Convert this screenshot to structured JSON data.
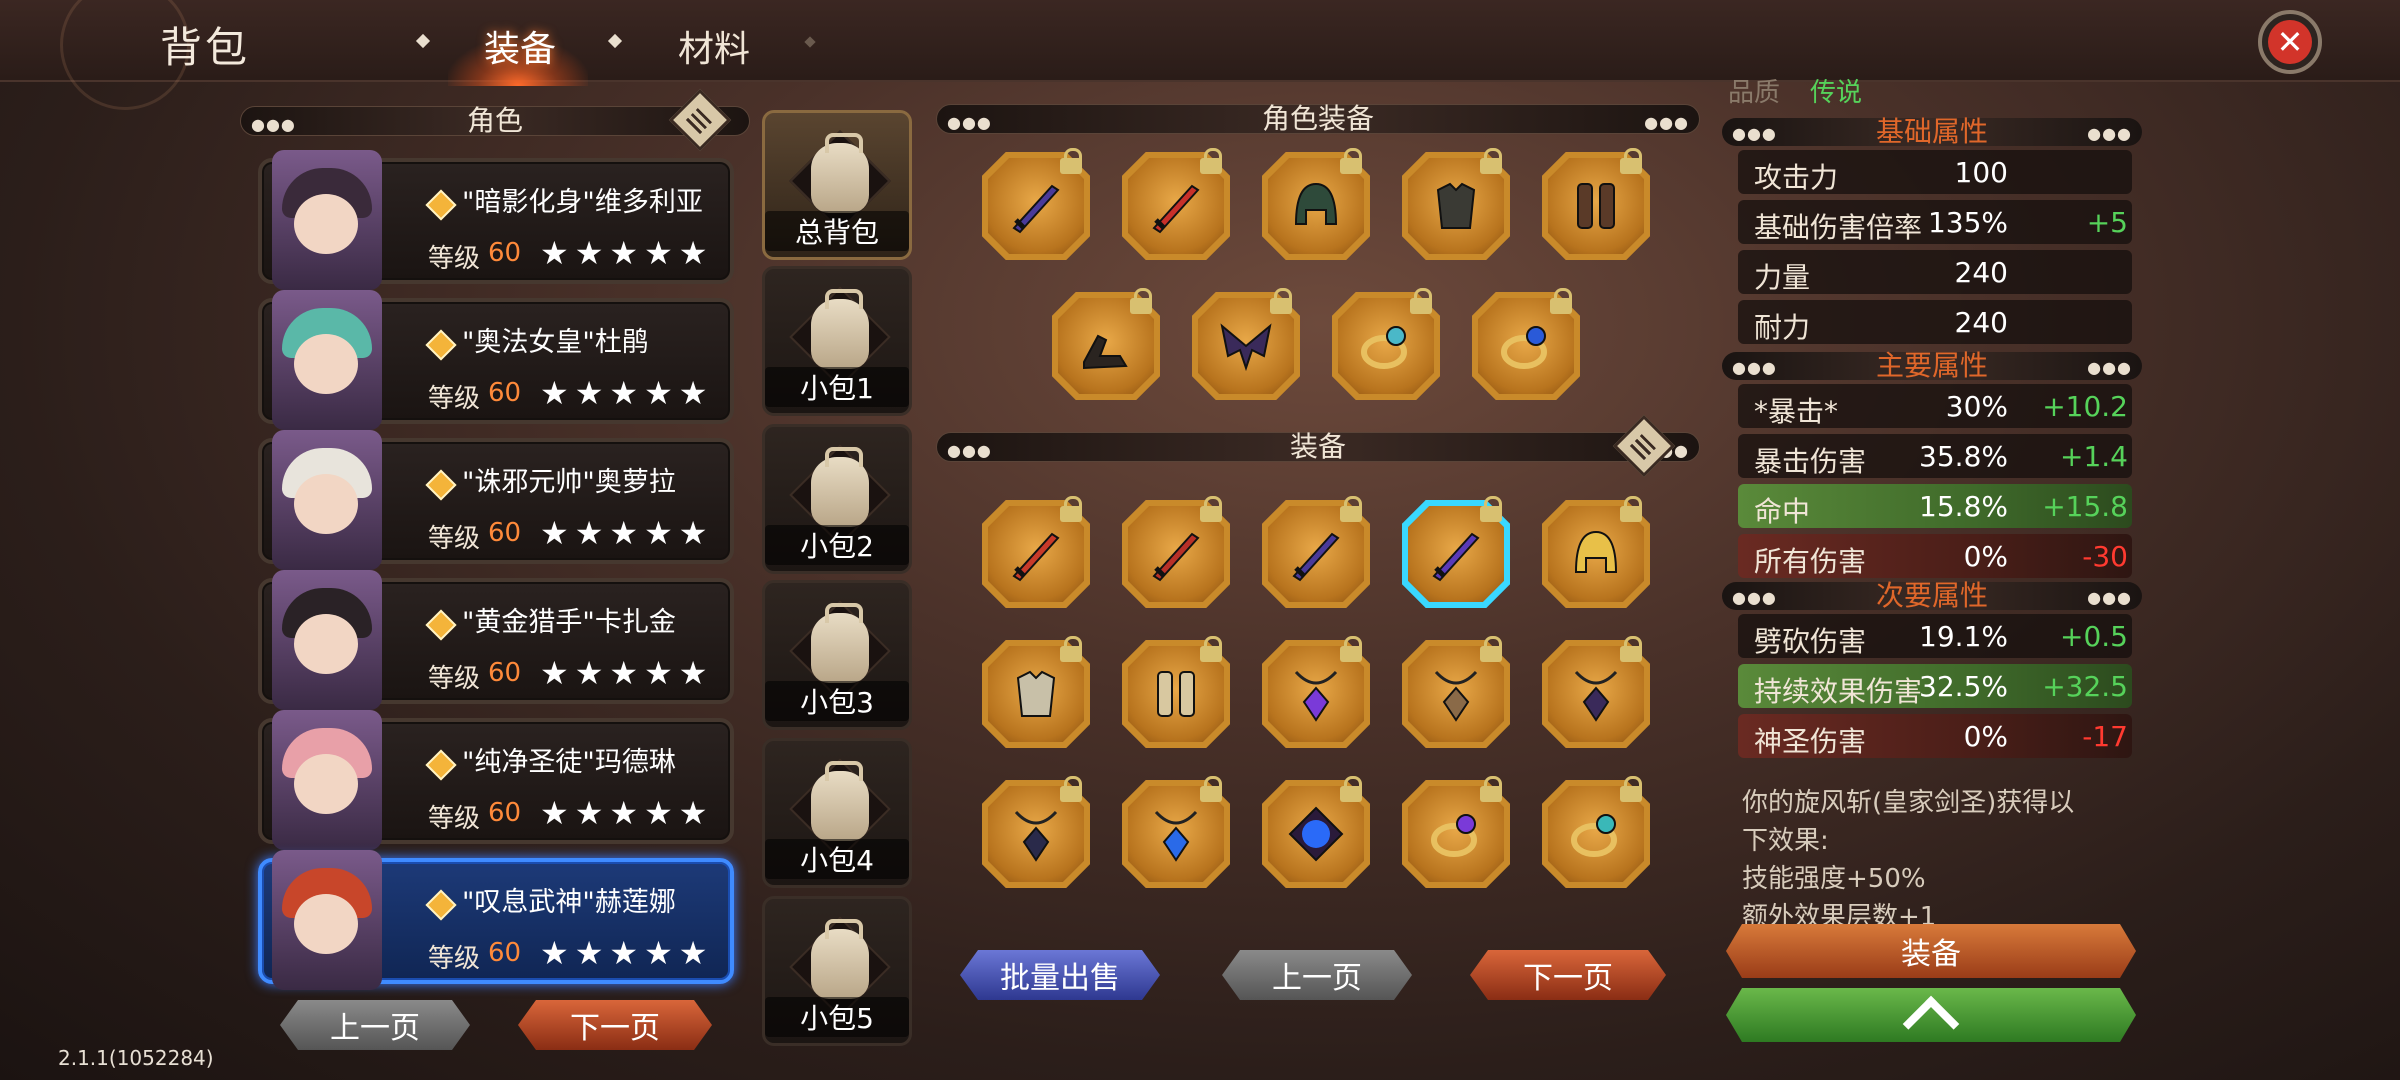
{
  "header": {
    "title": "背包",
    "tabs": [
      "装备",
      "材料"
    ],
    "active_tab": 0
  },
  "left": {
    "section_title": "角色",
    "characters": [
      {
        "name": "\"暗影化身\"维多利亚",
        "level_label": "等级",
        "level": "60",
        "stars": "★★★★★",
        "hair": "#3a2a3a"
      },
      {
        "name": "\"奥法女皇\"杜鹃",
        "level_label": "等级",
        "level": "60",
        "stars": "★★★★★",
        "hair": "#5ab8a8"
      },
      {
        "name": "\"诛邪元帅\"奥萝拉",
        "level_label": "等级",
        "level": "60",
        "stars": "★★★★★",
        "hair": "#e8e4dc"
      },
      {
        "name": "\"黄金猎手\"卡扎金",
        "level_label": "等级",
        "level": "60",
        "stars": "★★★★★",
        "hair": "#2a2226"
      },
      {
        "name": "\"纯净圣徒\"玛德琳",
        "level_label": "等级",
        "level": "60",
        "stars": "★★★★★",
        "hair": "#e8a0a8"
      },
      {
        "name": "\"叹息武神\"赫莲娜",
        "level_label": "等级",
        "level": "60",
        "stars": "★★★★★",
        "hair": "#c8462a"
      }
    ],
    "prev": "上一页",
    "next": "下一页"
  },
  "bags": [
    "总背包",
    "小包1",
    "小包2",
    "小包3",
    "小包4",
    "小包5"
  ],
  "equip": {
    "char_equip_title": "角色装备",
    "inventory_title": "装备",
    "char_slots_row1": [
      "dark-sword-icon",
      "red-blade-icon",
      "hood-icon",
      "armor-icon",
      "gauntlets-icon"
    ],
    "char_slots_row2": [
      "boots-icon",
      "bat-wings-icon",
      "ring-icon",
      "sapphire-ring-icon"
    ],
    "inv_row1": [
      "red-sword-icon",
      "serrated-blade-icon",
      "dark-sword-icon",
      "violet-sword-icon",
      "golden-helm-icon"
    ],
    "inv_row2": [
      "pauldron-icon",
      "bracers-icon",
      "violet-amulet-icon",
      "bronze-amulet-icon",
      "dark-amulet-icon"
    ],
    "inv_row3": [
      "obsidian-amulet-icon",
      "sapphire-necklace-icon",
      "blue-orb-icon",
      "violet-ring-icon",
      "teal-ring-icon"
    ],
    "batch_sell": "批量出售",
    "prev": "上一页",
    "next": "下一页"
  },
  "stats": {
    "quality_label": "品质",
    "quality_value": "传说",
    "basic_title": "基础属性",
    "basic": [
      {
        "name": "攻击力",
        "value": "100",
        "bonus": ""
      },
      {
        "name": "基础伤害倍率",
        "value": "135%",
        "bonus": "+5"
      },
      {
        "name": "力量",
        "value": "240",
        "bonus": ""
      },
      {
        "name": "耐力",
        "value": "240",
        "bonus": ""
      }
    ],
    "main_title": "主要属性",
    "main": [
      {
        "name": "*暴击*",
        "value": "30%",
        "bonus": "+10.2"
      },
      {
        "name": "暴击伤害",
        "value": "35.8%",
        "bonus": "+1.4"
      },
      {
        "name": "命中",
        "value": "15.8%",
        "bonus": "+15.8"
      },
      {
        "name": "所有伤害",
        "value": "0%",
        "bonus": "-30"
      }
    ],
    "secondary_title": "次要属性",
    "secondary": [
      {
        "name": "劈砍伤害",
        "value": "19.1%",
        "bonus": "+0.5"
      },
      {
        "name": "持续效果伤害",
        "value": "32.5%",
        "bonus": "+32.5"
      },
      {
        "name": "神圣伤害",
        "value": "0%",
        "bonus": "-17"
      }
    ],
    "description": [
      "你的旋风斩(皇家剑圣)获得以",
      "下效果:",
      "技能强度+50%",
      "额外效果层数+1"
    ],
    "equip_button": "装备"
  },
  "version": "2.1.1(1052284)"
}
